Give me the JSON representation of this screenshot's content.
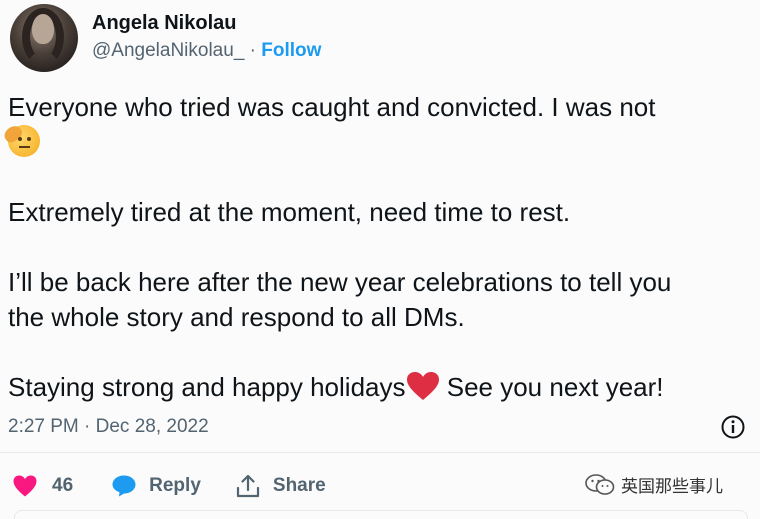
{
  "author": {
    "display_name": "Angela Nikolau",
    "handle": "@AngelaNikolau_",
    "separator": "·",
    "follow_label": "Follow"
  },
  "tweet": {
    "line1": "Everyone who tried was caught and  convicted. I was not",
    "emoji1": "saluting-face-emoji",
    "line2": "Extremely tired at the moment, need time to rest.",
    "line3a": "I’ll be back here after the new year celebrations to tell you",
    "line3b": "the whole story and respond to all DMs.",
    "line4a": "Staying strong and happy holidays",
    "emoji2": "red-heart-emoji",
    "line4b": " See you next year!",
    "timestamp": "2:27 PM · Dec 28, 2022"
  },
  "actions": {
    "like_count": "46",
    "reply_label": "Reply",
    "share_label": "Share"
  },
  "watermark": {
    "text": "英国那些事儿"
  },
  "colors": {
    "accent": "#1d9bf0",
    "like": "#f91880",
    "muted": "#536471",
    "heart": "#dd2e44"
  }
}
